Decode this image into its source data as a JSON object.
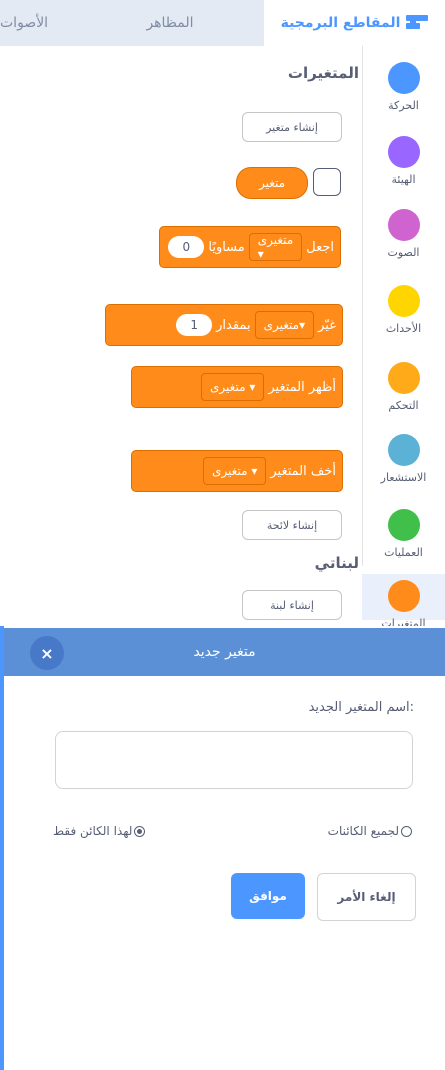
{
  "tabs": {
    "code": "المقاطع البرمجية",
    "costumes": "المظاهر",
    "sounds": "الأصوات"
  },
  "categories": [
    {
      "label": "الحركة",
      "color": "#4c97ff"
    },
    {
      "label": "الهيئة",
      "color": "#9966ff"
    },
    {
      "label": "الصوت",
      "color": "#cf63cf"
    },
    {
      "label": "الأحداث",
      "color": "#ffd500"
    },
    {
      "label": "التحكم",
      "color": "#ffab19"
    },
    {
      "label": "الاستشعار",
      "color": "#5cb1d6"
    },
    {
      "label": "العمليات",
      "color": "#40bf4a"
    },
    {
      "label": "المتغيرات",
      "color": "#ff8c1a"
    }
  ],
  "palette": {
    "variables_heading": "المتغيرات",
    "make_variable": "إنشاء متغير",
    "variable_reporter": "متغير",
    "set_block": {
      "word": "اجعل",
      "dropdown": "متغيرى ▾",
      "to": "مساويًا",
      "value": "0"
    },
    "change_block": {
      "word": "غيّر",
      "dropdown": "متغيرى▾",
      "by": "بمقدار",
      "value": "1"
    },
    "show_block": {
      "word": "أظهر المتغير",
      "dropdown": "متغيرى ▾"
    },
    "hide_block": {
      "word": "أخف المتغير",
      "dropdown": "متغيرى ▾"
    },
    "make_list": "إنشاء لائحة",
    "my_blocks_heading": "لبناتي",
    "make_block": "إنشاء لبنة"
  },
  "dialog": {
    "title": "متغير جديد",
    "close": "×",
    "name_label": "اسم المتغير الجديد:",
    "name_value": "",
    "for_all_sprites": "لجميع الكائنات",
    "this_sprite_only": "لهذا الكائن فقط",
    "selected_scope": "this_sprite_only",
    "ok": "موافق",
    "cancel": "إلغاء الأمر"
  },
  "colors": {
    "accent": "#4c97ff",
    "dialog_header": "#5b8fd6",
    "variables": "#ff8c1a",
    "ok_button": "#4c97ff"
  }
}
